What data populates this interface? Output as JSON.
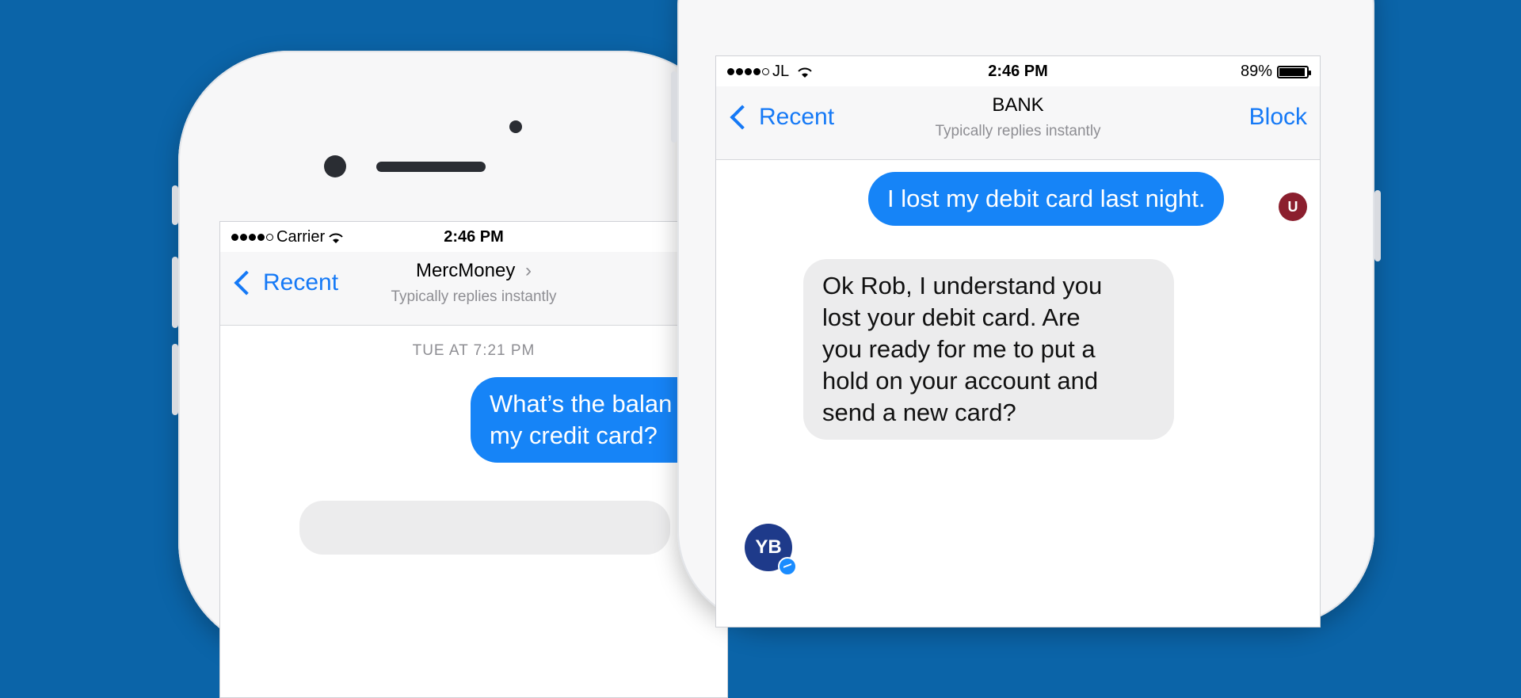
{
  "colors": {
    "background": "#0b64a8",
    "accent": "#1579f6",
    "bubble_out": "#1684f7",
    "bubble_in": "#ececed"
  },
  "back_phone": {
    "status": {
      "carrier": "Carrier",
      "time": "2:46 PM"
    },
    "nav": {
      "back_label": "Recent",
      "title": "MercMoney",
      "subtitle": "Typically replies instantly"
    },
    "timestamp": "TUE AT  7:21 PM",
    "messages": [
      {
        "from": "user",
        "text": "What’s the balan\nmy credit card?"
      }
    ]
  },
  "front_phone": {
    "status": {
      "carrier": "JL",
      "time": "2:46 PM",
      "battery": "89%",
      "battery_level": 0.89
    },
    "nav": {
      "back_label": "Recent",
      "title": "BANK",
      "subtitle": "Typically replies instantly",
      "right_action": "Block"
    },
    "messages": [
      {
        "from": "user",
        "text": "I lost my debit card last night.",
        "avatar": "U"
      },
      {
        "from": "bank",
        "text": "Ok Rob, I understand you\nlost your debit card. Are\nyou ready for me to put a\nhold on your account and\nsend a new card?",
        "avatar": "YB"
      }
    ]
  },
  "icons": [
    "signal-dots-icon",
    "wifi-icon",
    "battery-icon",
    "chevron-left-icon",
    "chevron-right-icon",
    "messenger-badge-icon"
  ]
}
